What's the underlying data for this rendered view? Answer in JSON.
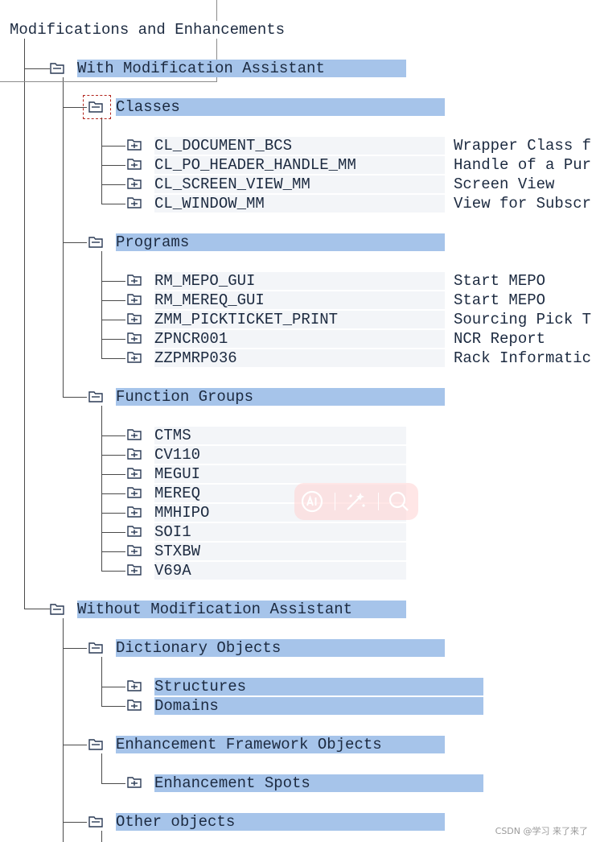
{
  "tree": {
    "root_label": "Modifications and Enhancements",
    "with_assistant": {
      "label": "With Modification Assistant",
      "classes": {
        "label": "Classes",
        "items": [
          {
            "name": "CL_DOCUMENT_BCS",
            "desc": "Wrapper Class f"
          },
          {
            "name": "CL_PO_HEADER_HANDLE_MM",
            "desc": "Handle of a Pur"
          },
          {
            "name": "CL_SCREEN_VIEW_MM",
            "desc": "Screen View"
          },
          {
            "name": "CL_WINDOW_MM",
            "desc": "View for Subscr"
          }
        ]
      },
      "programs": {
        "label": "Programs",
        "items": [
          {
            "name": "RM_MEPO_GUI",
            "desc": "Start MEPO"
          },
          {
            "name": "RM_MEREQ_GUI",
            "desc": "Start MEPO"
          },
          {
            "name": "ZMM_PICKTICKET_PRINT",
            "desc": "Sourcing Pick T"
          },
          {
            "name": "ZPNCR001",
            "desc": "NCR Report"
          },
          {
            "name": "ZZPMRP036",
            "desc": "Rack Informatic"
          }
        ]
      },
      "function_groups": {
        "label": "Function Groups",
        "items": [
          {
            "name": "CTMS"
          },
          {
            "name": "CV110"
          },
          {
            "name": "MEGUI"
          },
          {
            "name": "MEREQ"
          },
          {
            "name": "MMHIPO"
          },
          {
            "name": "SOI1"
          },
          {
            "name": "STXBW"
          },
          {
            "name": "V69A"
          }
        ]
      }
    },
    "without_assistant": {
      "label": "Without Modification Assistant",
      "dictionary": {
        "label": "Dictionary Objects",
        "items": [
          {
            "name": "Structures"
          },
          {
            "name": "Domains"
          }
        ]
      },
      "enhancement": {
        "label": "Enhancement Framework Objects",
        "items": [
          {
            "name": "Enhancement Spots"
          }
        ]
      },
      "other": {
        "label": "Other objects"
      }
    }
  },
  "icons": {
    "folder": "folder-icon",
    "object": "object-icon",
    "popup": [
      "ai-icon",
      "magic-wand-icon",
      "search-icon"
    ]
  },
  "colors": {
    "selected_band": "#a6c4ea",
    "light_band": "#f3f5f8",
    "tree_lines": "#4a4a4a",
    "selection_marker": "#b3261e"
  },
  "watermark": "CSDN @学习 来了来了"
}
